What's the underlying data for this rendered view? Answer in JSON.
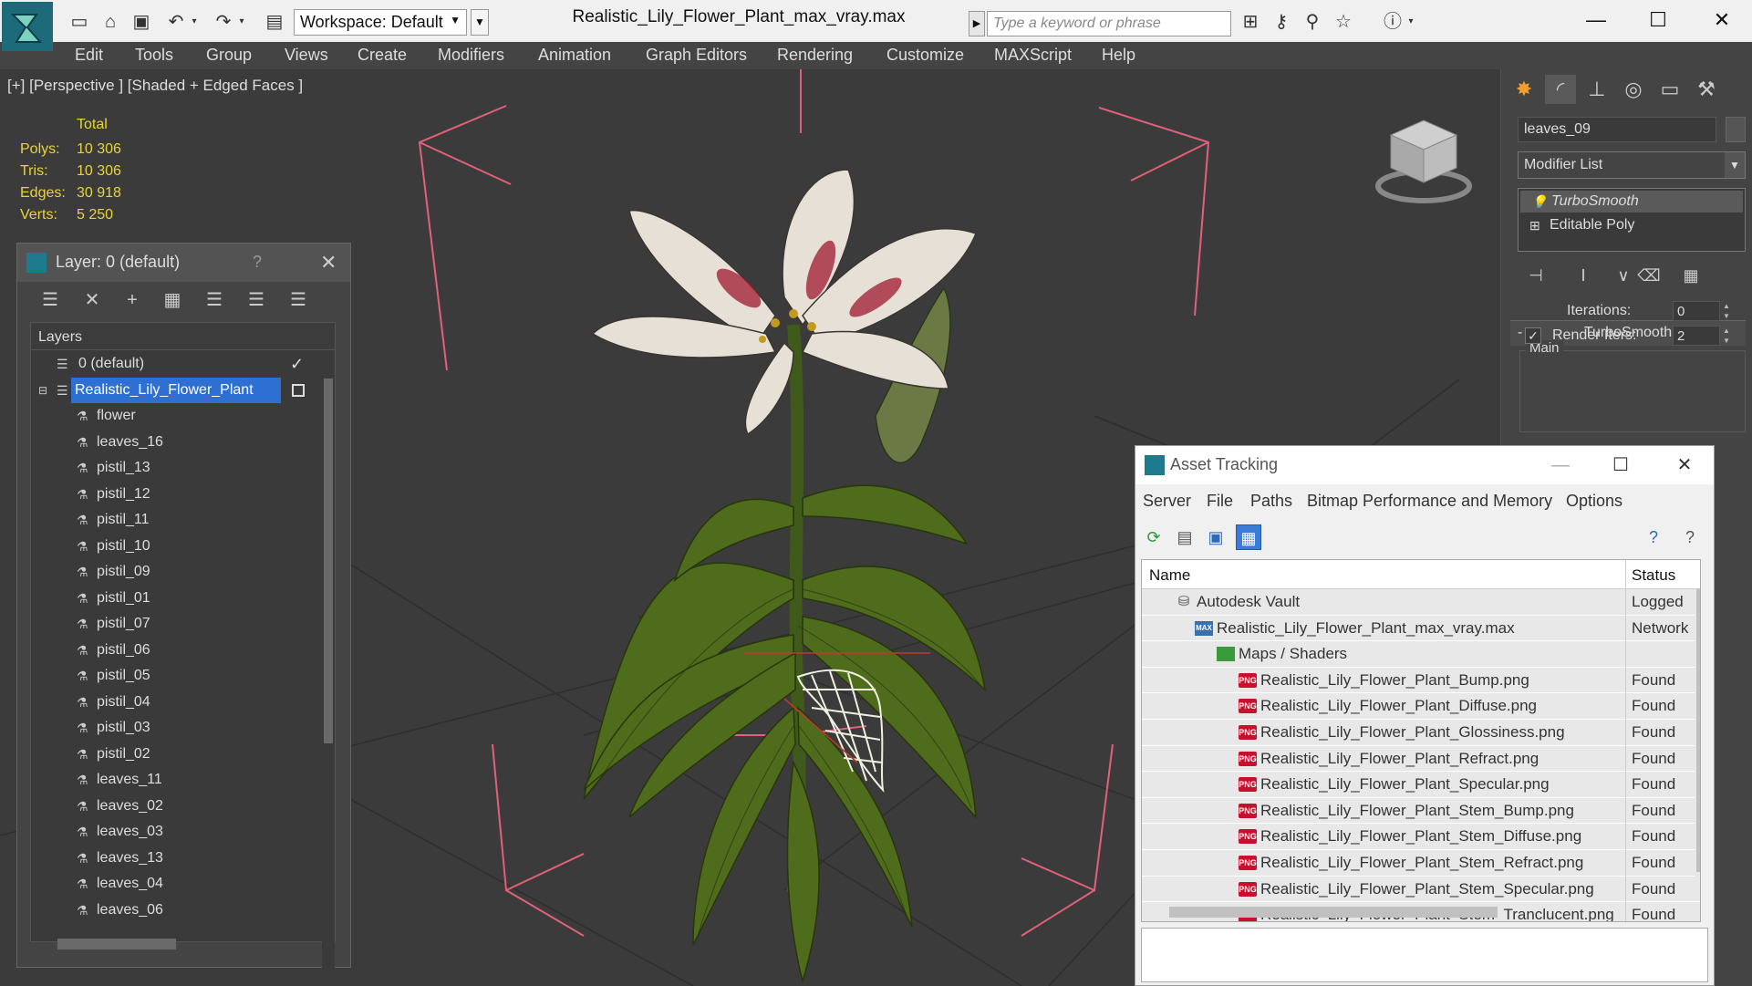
{
  "titlebar": {
    "workspace": "Workspace: Default",
    "window_title": "Realistic_Lily_Flower_Plant_max_vray.max",
    "search_placeholder": "Type a keyword or phrase"
  },
  "menu": [
    "Edit",
    "Tools",
    "Group",
    "Views",
    "Create",
    "Modifiers",
    "Animation",
    "Graph Editors",
    "Rendering",
    "Customize",
    "MAXScript",
    "Help"
  ],
  "viewport": {
    "label": "[+] [Perspective ] [Shaded + Edged Faces ]",
    "stats_header": "Total",
    "stats": [
      {
        "label": "Polys:",
        "value": "10 306"
      },
      {
        "label": "Tris:",
        "value": "10 306"
      },
      {
        "label": "Edges:",
        "value": "30 918"
      },
      {
        "label": "Verts:",
        "value": "5 250"
      }
    ]
  },
  "layer_dialog": {
    "title": "Layer: 0 (default)",
    "help": "?",
    "list_header": "Layers",
    "rows": [
      {
        "name": "0 (default)",
        "type": "layer"
      },
      {
        "name": "Realistic_Lily_Flower_Plant",
        "type": "layer"
      },
      {
        "name": "flower",
        "type": "object"
      },
      {
        "name": "leaves_16",
        "type": "object"
      },
      {
        "name": "pistil_13",
        "type": "object"
      },
      {
        "name": "pistil_12",
        "type": "object"
      },
      {
        "name": "pistil_11",
        "type": "object"
      },
      {
        "name": "pistil_10",
        "type": "object"
      },
      {
        "name": "pistil_09",
        "type": "object"
      },
      {
        "name": "pistil_01",
        "type": "object"
      },
      {
        "name": "pistil_07",
        "type": "object"
      },
      {
        "name": "pistil_06",
        "type": "object"
      },
      {
        "name": "pistil_05",
        "type": "object"
      },
      {
        "name": "pistil_04",
        "type": "object"
      },
      {
        "name": "pistil_03",
        "type": "object"
      },
      {
        "name": "pistil_02",
        "type": "object"
      },
      {
        "name": "leaves_11",
        "type": "object"
      },
      {
        "name": "leaves_02",
        "type": "object"
      },
      {
        "name": "leaves_03",
        "type": "object"
      },
      {
        "name": "leaves_13",
        "type": "object"
      },
      {
        "name": "leaves_04",
        "type": "object"
      },
      {
        "name": "leaves_06",
        "type": "object"
      }
    ]
  },
  "command_panel": {
    "object_name": "leaves_09",
    "modifier_list": "Modifier List",
    "stack": [
      "TurboSmooth",
      "Editable Poly"
    ],
    "rollout_toggle": "-",
    "rollout_title": "TurboSmooth",
    "group_label": "Main",
    "iterations_label": "Iterations:",
    "iterations_value": "0",
    "render_iters_label": "Render Iters:",
    "render_iters_value": "2"
  },
  "asset_tracking": {
    "title": "Asset Tracking",
    "menu": [
      "Server",
      "File",
      "Paths",
      "Bitmap Performance and Memory",
      "Options"
    ],
    "columns": {
      "name": "Name",
      "status": "Status"
    },
    "rows": [
      {
        "name": "Autodesk Vault",
        "status": "Logged",
        "icon": "vault-icon"
      },
      {
        "name": "Realistic_Lily_Flower_Plant_max_vray.max",
        "status": "Network",
        "icon": "max-file-icon"
      },
      {
        "name": "Maps / Shaders",
        "status": "",
        "icon": "maps-folder-icon"
      },
      {
        "name": "Realistic_Lily_Flower_Plant_Bump.png",
        "status": "Found",
        "icon": "png-icon"
      },
      {
        "name": "Realistic_Lily_Flower_Plant_Diffuse.png",
        "status": "Found",
        "icon": "png-icon"
      },
      {
        "name": "Realistic_Lily_Flower_Plant_Glossiness.png",
        "status": "Found",
        "icon": "png-icon"
      },
      {
        "name": "Realistic_Lily_Flower_Plant_Refract.png",
        "status": "Found",
        "icon": "png-icon"
      },
      {
        "name": "Realistic_Lily_Flower_Plant_Specular.png",
        "status": "Found",
        "icon": "png-icon"
      },
      {
        "name": "Realistic_Lily_Flower_Plant_Stem_Bump.png",
        "status": "Found",
        "icon": "png-icon"
      },
      {
        "name": "Realistic_Lily_Flower_Plant_Stem_Diffuse.png",
        "status": "Found",
        "icon": "png-icon"
      },
      {
        "name": "Realistic_Lily_Flower_Plant_Stem_Refract.png",
        "status": "Found",
        "icon": "png-icon"
      },
      {
        "name": "Realistic_Lily_Flower_Plant_Stem_Specular.png",
        "status": "Found",
        "icon": "png-icon"
      },
      {
        "name": "Realistic_Lily_Flower_Plant_Stem_Tranclucent.png",
        "status": "Found",
        "icon": "png-icon"
      }
    ]
  },
  "colors": {
    "stats_yellow": "#e8d43a",
    "selection_blue": "#2d6fd3",
    "bbox_pink": "#e0607a",
    "leaf_green": "#4f6b1c"
  }
}
